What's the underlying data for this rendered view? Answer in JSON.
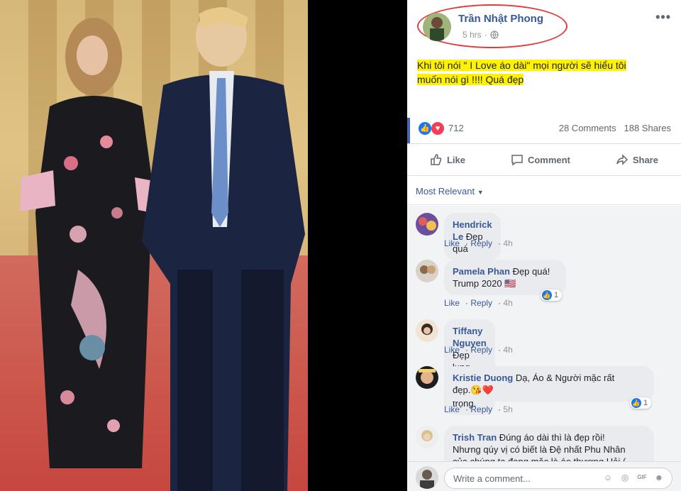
{
  "post": {
    "author": "Trần Nhật Phong",
    "time": "5 hrs",
    "text": "Khi tôi nói \" I Love áo dài\" mọi người sẽ hiểu tôi muốn nói gì !!!! Quá đẹp",
    "reaction_count": "712",
    "comments_count": "28 Comments",
    "shares_count": "188 Shares",
    "highlight_color": "#fff200",
    "circle_color": "#e23b3b"
  },
  "actions": {
    "like": "Like",
    "comment": "Comment",
    "share": "Share"
  },
  "sort_label": "Most Relevant",
  "comments": [
    {
      "name": "Hendrick Le",
      "text": "Đẹp quá",
      "like": "Like",
      "reply": "Reply",
      "time": "4h"
    },
    {
      "name": "Pamela Phan",
      "text": "Đẹp quá!",
      "text2": "Trump 2020 🇺🇸",
      "like": "Like",
      "reply": "Reply",
      "time": "4h",
      "likes": "1"
    },
    {
      "name": "Tiffany Nguyen",
      "text": "Đẹp lung linh, sang trọng.",
      "like": "Like",
      "reply": "Reply",
      "time": "4h"
    },
    {
      "name": "Kristie Duong",
      "text": "Dạ, Áo & Người mặc rất",
      "text2": "đẹp.😘❤️",
      "like": "Like",
      "reply": "Reply",
      "time": "5h",
      "likes": "1"
    },
    {
      "name": "Trish Tran",
      "text": "Đúng áo dài thì là đẹp rồi!",
      "text2": "Nhưng qúy vị có biết là Đệ nhất Phu Nhân",
      "text3": "của chúng ta đang mặc là áo thương Hải ("
    }
  ],
  "write_placeholder": "Write a comment..."
}
